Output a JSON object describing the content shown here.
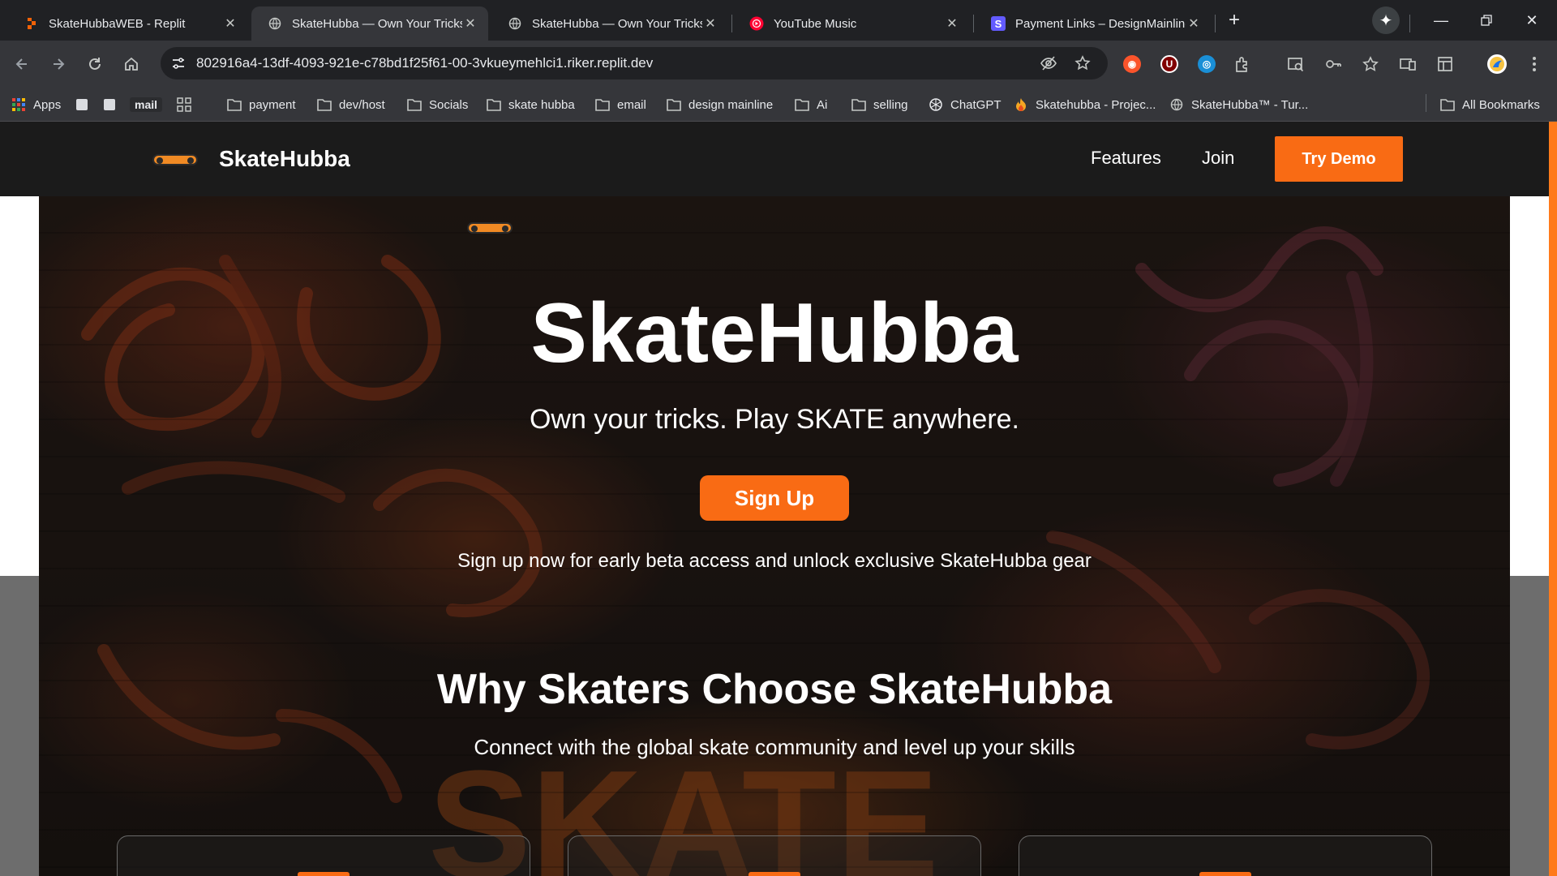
{
  "browser": {
    "tabs": [
      {
        "title": "SkateHubbaWEB - Replit",
        "icon": "replit-icon",
        "active": false
      },
      {
        "title": "SkateHubba — Own Your Tricks",
        "icon": "globe-icon",
        "active": true
      },
      {
        "title": "SkateHubba — Own Your Tricks",
        "icon": "globe-icon",
        "active": false
      },
      {
        "title": "YouTube Music",
        "icon": "youtube-music-icon",
        "active": false
      },
      {
        "title": "Payment Links – DesignMainline",
        "icon": "stripe-icon",
        "active": false
      }
    ],
    "new_tab_label": "+",
    "url": "802916a4-13df-4093-921e-c78bd1f25f61-00-3vkueymehlci1.riker.replit.dev",
    "bookmarks": [
      {
        "label": "Apps",
        "icon": "apps-grid-icon"
      },
      {
        "label": "",
        "icon": "bookmark-square-icon"
      },
      {
        "label": "",
        "icon": "bookmark-square-icon"
      },
      {
        "label": "mail",
        "icon": "mail-icon"
      },
      {
        "label": "",
        "icon": "grid-icon"
      },
      {
        "label": "payment",
        "icon": "folder-icon"
      },
      {
        "label": "dev/host",
        "icon": "folder-icon"
      },
      {
        "label": "Socials",
        "icon": "folder-icon"
      },
      {
        "label": "skate hubba",
        "icon": "folder-icon"
      },
      {
        "label": "email",
        "icon": "folder-icon"
      },
      {
        "label": "design mainline",
        "icon": "folder-icon"
      },
      {
        "label": "Ai",
        "icon": "folder-icon"
      },
      {
        "label": "selling",
        "icon": "folder-icon"
      },
      {
        "label": "ChatGPT",
        "icon": "openai-icon"
      },
      {
        "label": "Skatehubba - Projec...",
        "icon": "flame-icon"
      },
      {
        "label": "SkateHubba™ - Tur...",
        "icon": "globe-icon"
      }
    ],
    "all_bookmarks": "All Bookmarks"
  },
  "site": {
    "brand": "SkateHubba",
    "nav": {
      "features": "Features",
      "join": "Join",
      "try_demo": "Try Demo"
    },
    "hero": {
      "title": "SkateHubba",
      "subtitle": "Own your tricks. Play SKATE anywhere.",
      "cta": "Sign Up",
      "note": "Sign up now for early beta access and unlock exclusive SkateHubba gear"
    },
    "features": {
      "title": "Why Skaters Choose SkateHubba",
      "subtitle": "Connect with the global skate community and level up your skills"
    },
    "colors": {
      "accent": "#f96b14",
      "header_bg": "#1b1b1b",
      "text": "#ffffff"
    }
  }
}
